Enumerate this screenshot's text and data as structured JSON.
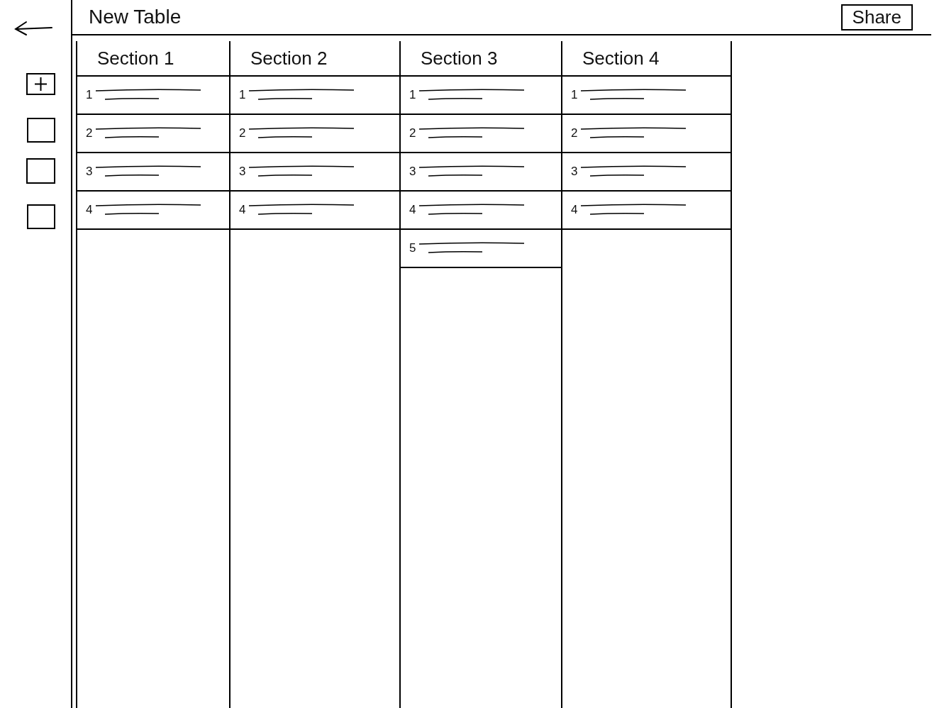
{
  "header": {
    "title": "New Table",
    "share_button": "Share"
  },
  "sections": [
    {
      "title": "Section 1",
      "rows": [
        {
          "number": "1"
        },
        {
          "number": "2"
        },
        {
          "number": "3"
        },
        {
          "number": "4"
        }
      ]
    },
    {
      "title": "Section 2",
      "rows": [
        {
          "number": "1"
        },
        {
          "number": "2"
        },
        {
          "number": "3"
        },
        {
          "number": "4"
        }
      ]
    },
    {
      "title": "Section 3",
      "rows": [
        {
          "number": "1"
        },
        {
          "number": "2"
        },
        {
          "number": "3"
        },
        {
          "number": "4"
        },
        {
          "number": "5"
        }
      ]
    },
    {
      "title": "Section 4",
      "rows": [
        {
          "number": "1"
        },
        {
          "number": "2"
        },
        {
          "number": "3"
        },
        {
          "number": "4"
        }
      ]
    }
  ]
}
